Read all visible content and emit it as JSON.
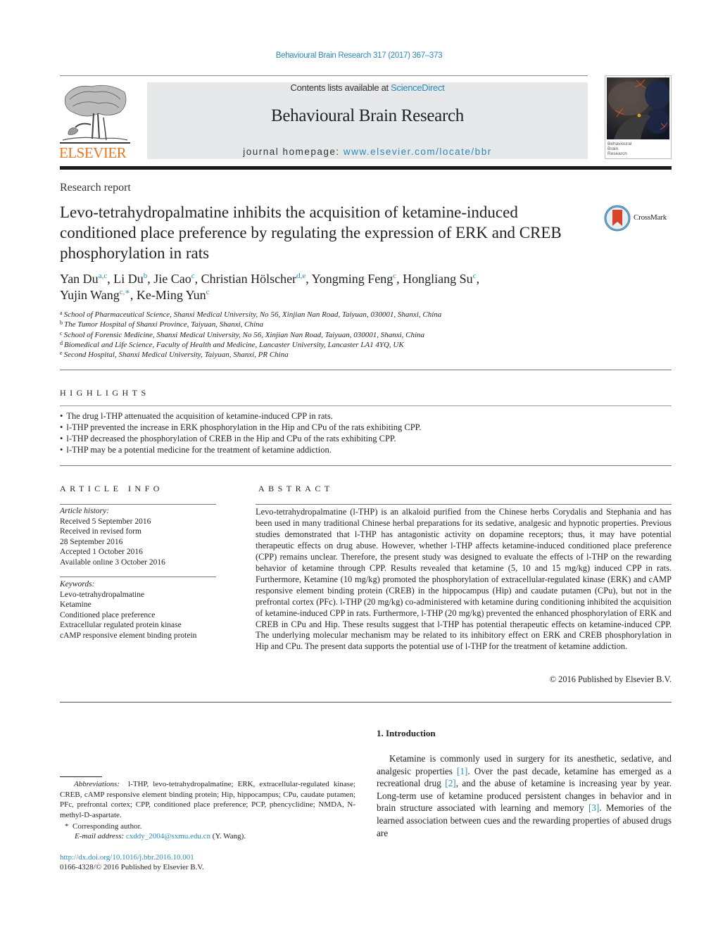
{
  "header": {
    "journal_reference": "Behavioural Brain Research 317 (2017) 367–373",
    "contents_prefix": "Contents lists available at ",
    "contents_link": "ScienceDirect",
    "journal_title": "Behavioural Brain Research",
    "homepage_prefix": "journal homepage: ",
    "homepage_link": "www.elsevier.com/locate/bbr",
    "publisher_logo_text": "ELSEVIER",
    "cover_title_lines": [
      "Behavioural",
      "Brain",
      "Research"
    ],
    "colors": {
      "link": "#2a8ab8",
      "elsevier_orange": "#e87722",
      "banner_bg": "#e7e8e9"
    }
  },
  "article": {
    "type": "Research report",
    "title": "Levo-tetrahydropalmatine inhibits the acquisition of ketamine-induced conditioned place preference by regulating the expression of ERK and CREB phosphorylation in rats",
    "crossmark_label": "CrossMark",
    "authors": [
      {
        "name": "Yan Du",
        "aff": "a,c"
      },
      {
        "name": "Li Du",
        "aff": "b"
      },
      {
        "name": "Jie Cao",
        "aff": "c"
      },
      {
        "name": "Christian Hölscher",
        "aff": "d,e"
      },
      {
        "name": "Yongming Feng",
        "aff": "c"
      },
      {
        "name": "Hongliang Su",
        "aff": "c"
      },
      {
        "name": "Yujin Wang",
        "aff": "c,∗"
      },
      {
        "name": "Ke-Ming Yun",
        "aff": "c"
      }
    ],
    "affiliations": [
      {
        "key": "a",
        "text": "School of Pharmaceutical Science, Shanxi Medical University, No 56, Xinjian Nan Road, Taiyuan, 030001, Shanxi, China"
      },
      {
        "key": "b",
        "text": "The Tumor Hospital of Shanxi Province, Taiyuan, Shanxi, China"
      },
      {
        "key": "c",
        "text": "School of Forensic Medicine, Shanxi Medical University, No 56, Xinjian Nan Road, Taiyuan, 030001, Shanxi, China"
      },
      {
        "key": "d",
        "text": "Biomedical and Life Science, Faculty of Health and Medicine, Lancaster University, Lancaster LA1 4YQ, UK"
      },
      {
        "key": "e",
        "text": "Second Hospital, Shanxi Medical University, Taiyuan, Shanxi, PR China"
      }
    ]
  },
  "highlights": {
    "title": "HIGHLIGHTS",
    "items": [
      "The drug l-THP attenuated the acquisition of ketamine-induced CPP in rats.",
      "l-THP prevented the increase in ERK phosphorylation in the Hip and CPu of the rats exhibiting CPP.",
      "l-THP decreased the phosphorylation of CREB in the Hip and CPu of the rats exhibiting CPP.",
      "l-THP may be a potential medicine for the treatment of ketamine addiction."
    ]
  },
  "article_info": {
    "title": "ARTICLE INFO",
    "history_label": "Article history:",
    "history": [
      "Received 5 September 2016",
      "Received in revised form",
      "28 September 2016",
      "Accepted 1 October 2016",
      "Available online 3 October 2016"
    ],
    "keywords_label": "Keywords:",
    "keywords": [
      "Levo-tetrahydropalmatine",
      "Ketamine",
      "Conditioned place preference",
      "Extracellular regulated protein kinase",
      "cAMP responsive element binding protein"
    ]
  },
  "abstract": {
    "title": "ABSTRACT",
    "body": "Levo-tetrahydropalmatine (l-THP) is an alkaloid purified from the Chinese herbs Corydalis and Stephania and has been used in many traditional Chinese herbal preparations for its sedative, analgesic and hypnotic properties. Previous studies demonstrated that l-THP has antagonistic activity on dopamine receptors; thus, it may have potential therapeutic effects on drug abuse. However, whether l-THP affects ketamine-induced conditioned place preference (CPP) remains unclear. Therefore, the present study was designed to evaluate the effects of l-THP on the rewarding behavior of ketamine through CPP. Results revealed that ketamine (5, 10 and 15 mg/kg) induced CPP in rats. Furthermore, Ketamine (10 mg/kg) promoted the phosphorylation of extracellular-regulated kinase (ERK) and cAMP responsive element binding protein (CREB) in the hippocampus (Hip) and caudate putamen (CPu), but not in the prefrontal cortex (PFc). l-THP (20 mg/kg) co-administered with ketamine during conditioning inhibited the acquisition of ketamine-induced CPP in rats. Furthermore, l-THP (20 mg/kg) prevented the enhanced phosphorylation of ERK and CREB in CPu and Hip. These results suggest that l-THP has potential therapeutic effects on ketamine-induced CPP. The underlying molecular mechanism may be related to its inhibitory effect on ERK and CREB phosphorylation in Hip and CPu. The present data supports the potential use of l-THP for the treatment of ketamine addiction.",
    "copyright": "© 2016 Published by Elsevier B.V."
  },
  "introduction": {
    "heading": "1.  Introduction",
    "segments": [
      {
        "text": "Ketamine is commonly used in surgery for its anesthetic, sedative, and analgesic properties ",
        "ref": false
      },
      {
        "text": "[1]",
        "ref": true
      },
      {
        "text": ". Over the past decade, ketamine has emerged as a recreational drug ",
        "ref": false
      },
      {
        "text": "[2]",
        "ref": true
      },
      {
        "text": ", and the abuse of ketamine is increasing year by year. Long-term use of ketamine produced persistent changes in behavior and in brain structure associated with learning and memory ",
        "ref": false
      },
      {
        "text": "[3]",
        "ref": true
      },
      {
        "text": ". Memories of the learned association between cues and the rewarding properties of abused drugs are",
        "ref": false
      }
    ]
  },
  "footnotes": {
    "abbreviations_label": "Abbreviations:",
    "abbreviations": "l-THP, levo-tetrahydropalmatine; ERK, extracellular-regulated kinase; CREB, cAMP responsive element binding protein; Hip, hippocampus; CPu, caudate putamen; PFc, prefrontal cortex; CPP, conditioned place preference; PCP, phencyclidine; NMDA, N-methyl-D-aspartate.",
    "corresponding_marker": "*",
    "corresponding_text": "Corresponding author.",
    "email_label": "E-mail address:",
    "email": "cxddy_2004@sxmu.edu.cn",
    "email_suffix": " (Y. Wang).",
    "doi": "http://dx.doi.org/10.1016/j.bbr.2016.10.001",
    "issn_line": "0166-4328/© 2016 Published by Elsevier B.V."
  }
}
